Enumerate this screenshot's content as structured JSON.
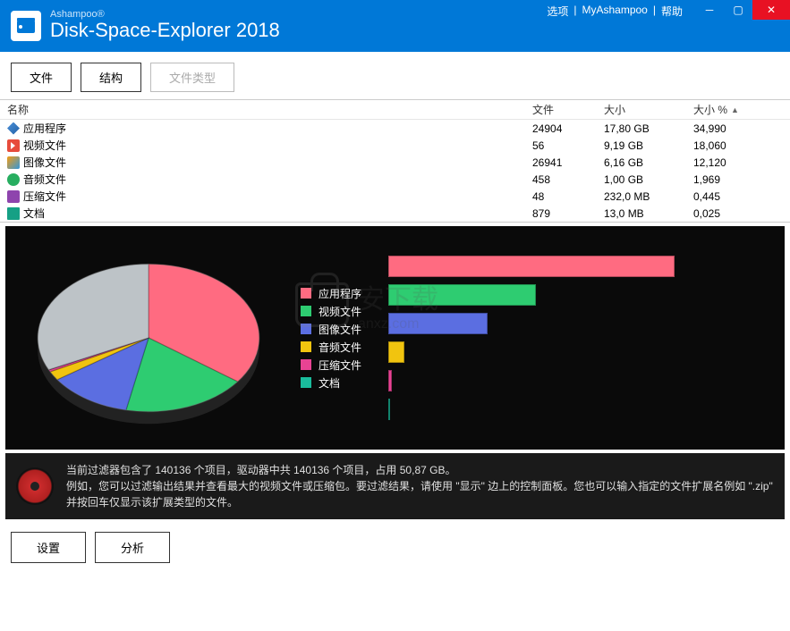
{
  "titlebar": {
    "brand": "Ashampoo®",
    "title": "Disk-Space-Explorer 2018",
    "links": {
      "options": "选项",
      "myashampoo": "MyAshampoo",
      "help": "帮助"
    }
  },
  "tabs": {
    "files": "文件",
    "structure": "结构",
    "filetypes": "文件类型"
  },
  "table": {
    "headers": {
      "name": "名称",
      "files": "文件",
      "size": "大小",
      "pct": "大小 %"
    },
    "rows": [
      {
        "icon": "app",
        "name": "应用程序",
        "files": "24904",
        "size": "17,80 GB",
        "pct": "34,990"
      },
      {
        "icon": "video",
        "name": "视频文件",
        "files": "56",
        "size": "9,19 GB",
        "pct": "18,060"
      },
      {
        "icon": "image",
        "name": "图像文件",
        "files": "26941",
        "size": "6,16 GB",
        "pct": "12,120"
      },
      {
        "icon": "audio",
        "name": "音频文件",
        "files": "458",
        "size": "1,00 GB",
        "pct": "1,969"
      },
      {
        "icon": "archive",
        "name": "压缩文件",
        "files": "48",
        "size": "232,0 MB",
        "pct": "0,445"
      },
      {
        "icon": "doc",
        "name": "文档",
        "files": "879",
        "size": "13,0 MB",
        "pct": "0,025"
      }
    ]
  },
  "chart_data": {
    "type": "pie",
    "title": "",
    "categories": [
      "应用程序",
      "视频文件",
      "图像文件",
      "音频文件",
      "压缩文件",
      "文档"
    ],
    "values": [
      34.99,
      18.06,
      12.12,
      1.969,
      0.445,
      0.025
    ],
    "colors": [
      "#ff6b81",
      "#2ecc71",
      "#5b6ee1",
      "#f1c40f",
      "#e84393",
      "#1abc9c"
    ],
    "bars": {
      "type": "bar",
      "categories": [
        "应用程序",
        "视频文件",
        "图像文件",
        "音频文件",
        "压缩文件",
        "文档"
      ],
      "values": [
        34.99,
        18.06,
        12.12,
        1.969,
        0.445,
        0.025
      ]
    }
  },
  "info": {
    "line1": "当前过滤器包含了 140136 个项目，驱动器中共 140136 个项目，占用 50,87 GB。",
    "line2": "例如，您可以过滤输出结果并查看最大的视频文件或压缩包。要过滤结果，请使用 \"显示\" 边上的控制面板。您也可以输入指定的文件扩展名例如 \".zip\" 并按回车仅显示该扩展类型的文件。"
  },
  "buttons": {
    "settings": "设置",
    "analyze": "分析"
  },
  "watermark": {
    "text1": "安下载",
    "text2": "anxz.com"
  }
}
